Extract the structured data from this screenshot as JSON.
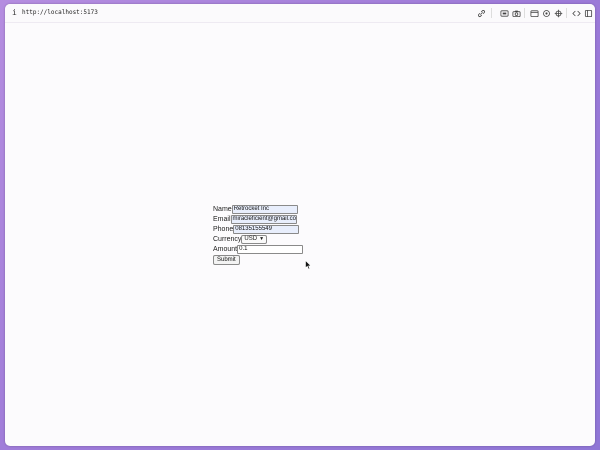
{
  "browser": {
    "url": "http://localhost:5173",
    "info_icon": "i",
    "toolbar_icons": [
      "link-icon",
      "screenshot-icon",
      "camera-icon",
      "window-icon",
      "settings-icon",
      "crosshair-icon",
      "code-icon",
      "sidebar-icon"
    ]
  },
  "form": {
    "name_label": "Name",
    "name_value": "Retrocket Inc",
    "email_label": "Email",
    "email_value": "miracleficient@gmail.com",
    "phone_label": "Phone",
    "phone_value": "08135155549",
    "currency_label": "Currency",
    "currency_value": "USD",
    "amount_label": "Amount",
    "amount_value": "0.1",
    "submit_label": "Submit"
  },
  "colors": {
    "background_gradient_start": "#b58de0",
    "background_gradient_end": "#8f76d6",
    "page_background": "#fcfbfd",
    "autofill_background": "#e8eefc"
  }
}
